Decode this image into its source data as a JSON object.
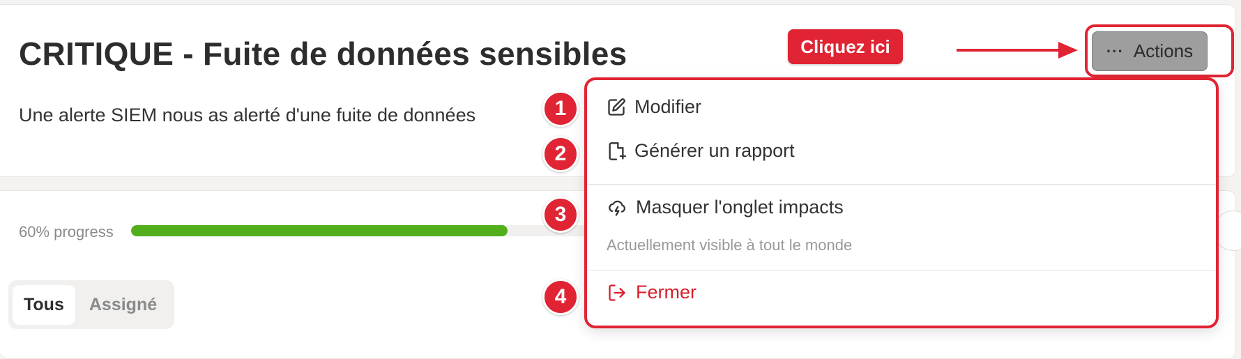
{
  "page": {
    "title": "CRITIQUE - Fuite de données sensibles",
    "description": "Une alerte SIEM nous as alerté d'une fuite de données",
    "progress_label": "60% progress",
    "progress_value": 0.6,
    "tabs": [
      {
        "label": "Tous",
        "active": true
      },
      {
        "label": "Assigné",
        "active": false
      }
    ]
  },
  "annotation": {
    "callout": "Cliquez ici",
    "badges": [
      "1",
      "2",
      "3",
      "4"
    ],
    "accent_color": "#e02433"
  },
  "actions": {
    "label": "Actions",
    "dots": "···"
  },
  "menu": {
    "items": [
      {
        "label": "Modifier",
        "icon": "edit-icon"
      },
      {
        "label": "Générer un rapport",
        "icon": "file-plus-icon"
      },
      {
        "label": "Masquer l'onglet impacts",
        "icon": "cloud-lightning-icon",
        "subtitle": "Actuellement visible à tout le monde"
      },
      {
        "label": "Fermer",
        "icon": "logout-icon",
        "danger": true
      }
    ]
  }
}
